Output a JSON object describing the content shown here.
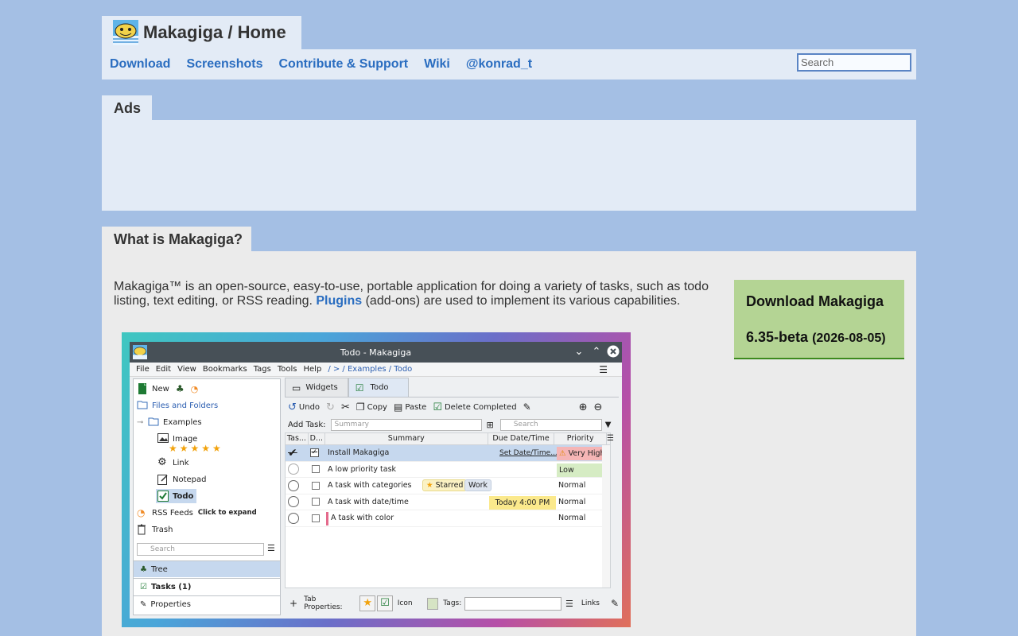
{
  "header": {
    "title": "Makagiga / Home",
    "nav": [
      "Download",
      "Screenshots",
      "Contribute & Support",
      "Wiki",
      "@konrad_t"
    ],
    "search_placeholder": "Search"
  },
  "ads": {
    "title": "Ads"
  },
  "what": {
    "title": "What is Makagiga?",
    "intro_before": "Makagiga™ is an open-source, easy-to-use, portable application for doing a variety of tasks, such as todo listing, text editing, or RSS reading.",
    "plugins_link": "Plugins",
    "intro_after": "(add-ons) are used to implement its various capabilities."
  },
  "download": {
    "title": "Download Makagiga",
    "version": "6.35-beta",
    "date": "(2026-08-05)"
  },
  "app": {
    "window_title": "Todo - Makagiga",
    "menu": [
      "File",
      "Edit",
      "View",
      "Bookmarks",
      "Tags",
      "Tools",
      "Help"
    ],
    "breadcrumb": "/ > / Examples / Todo",
    "tree": {
      "new": "New",
      "files": "Files and Folders",
      "examples": "Examples",
      "image": "Image",
      "stars": "★★★★★",
      "link": "Link",
      "notepad": "Notepad",
      "todo": "Todo",
      "rss": "RSS Feeds",
      "rss_hint": "Click to expand",
      "trash": "Trash"
    },
    "left_search": "Search",
    "left_tabs": [
      "Tree",
      "Tasks (1)",
      "Properties"
    ],
    "tabs": [
      "Widgets",
      "Todo"
    ],
    "toolbar": {
      "undo": "Undo",
      "copy": "Copy",
      "paste": "Paste",
      "delete_completed": "Delete Completed"
    },
    "add_task_label": "Add Task:",
    "summary_placeholder": "Summary",
    "search_placeholder": "Search",
    "columns": [
      "Tas...",
      "D...",
      "Summary",
      "Due Date/Time",
      "Priority"
    ],
    "rows": [
      {
        "summary": "Install Makagiga",
        "due": "Set Date/Time...",
        "priority": "Very High"
      },
      {
        "summary": "A low priority task",
        "due": "",
        "priority": "Low"
      },
      {
        "summary": "A task with categories",
        "tag1": "Starred",
        "tag2": "Work",
        "due": "",
        "priority": "Normal"
      },
      {
        "summary": "A task with date/time",
        "due": "Today  4:00 PM",
        "priority": "Normal"
      },
      {
        "summary": "A task with color",
        "due": "",
        "priority": "Normal"
      }
    ],
    "bottom": {
      "tab_properties": "Tab Properties:",
      "icon": "Icon",
      "tags": "Tags:",
      "links": "Links"
    }
  }
}
